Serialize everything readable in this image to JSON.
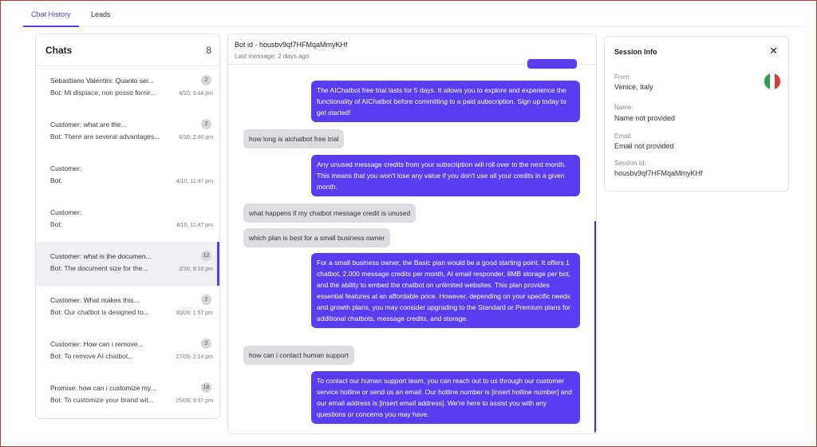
{
  "tabs": [
    {
      "label": "Chat History",
      "active": true
    },
    {
      "label": "Leads",
      "active": false
    }
  ],
  "chats": {
    "title": "Chats",
    "count": "8",
    "items": [
      {
        "name": "Sebastiano Valentini: Quanto sei...",
        "preview": "Bot: Mi dispiace, non posso fornir...",
        "date": "4/10, 9:44 pm",
        "badge": "2"
      },
      {
        "name": "Customer: what are the...",
        "preview": "Bot: There are several advantages...",
        "date": "4/10, 2:40 pm",
        "badge": "2"
      },
      {
        "name": "Customer:",
        "preview": "Bot:",
        "date": "4/10, 11:47 pm",
        "badge": ""
      },
      {
        "name": "Customer:",
        "preview": "Bot:",
        "date": "4/10, 11:47 pm",
        "badge": ""
      },
      {
        "name": "Customer: what is the documen...",
        "preview": "Bot: The document size for the...",
        "date": "2/10, 9:10 pm",
        "badge": "12"
      },
      {
        "name": "Customer: What makes this...",
        "preview": "Bot: Our chatbot is designed to...",
        "date": "30/09, 1:57 pm",
        "badge": "2"
      },
      {
        "name": "Customer: How can i remove...",
        "preview": "Bot: To remove AI chatbot...",
        "date": "27/09, 2:14 pm",
        "badge": "2"
      },
      {
        "name": "Promise: how can i customize my...",
        "preview": "Bot: To customize your brand wit...",
        "date": "25/09, 9:37 pm",
        "badge": "18"
      }
    ]
  },
  "conversation": {
    "bot_id": "Bot id - housbv9qf7HFMqaMmyKHf",
    "last_message": "Last message: 2 days ago",
    "messages": [
      {
        "from": "bot",
        "text": "The AIChatbot free trial lasts for 5 days. It allows you to explore and experience the functionality of AIChatbot before committing to a paid subscription. Sign up today to get started!"
      },
      {
        "from": "user",
        "text": "how long is aichatbot free trial"
      },
      {
        "from": "bot",
        "text": "Any unused message credits from your subscription will roll over to the next month. This means that you won't lose any value if you don't use all your credits in a given month."
      },
      {
        "from": "user",
        "text": "what happens if my chatbot message credit is unused"
      },
      {
        "from": "user",
        "text": "which plan is best for a small business owner"
      },
      {
        "from": "bot",
        "text": "For a small business owner, the Basic plan would be a good starting point. It offers 1 chatbot, 2,000 message credits per month, AI email responder, 8MB storage per bot, and the ability to embed the chatbot on unlimited websites. This plan provides essential features at an affordable price. However, depending on your specific needs and growth plans, you may consider upgrading to the Standard or Premium plans for additional chatbots, message credits, and storage."
      },
      {
        "from": "user",
        "text": "how can i contact human support"
      },
      {
        "from": "bot",
        "text": "To contact our human support team, you can reach out to us through our customer service hotline or send us an email. Our hotline number is [insert hotline number] and our email address is [insert email address]. We're here to assist you with any questions or concerns you may have."
      }
    ]
  },
  "session": {
    "title": "Session Info",
    "close_icon": "close-icon",
    "from_label": "From:",
    "from_value": "Venice, Italy",
    "flag_icon": "italy-flag-icon",
    "name_label": "Name:",
    "name_value": "Name not provided",
    "email_label": "Email:",
    "email_value": "Email not provided",
    "session_label": "Session Id:",
    "session_value": "housbv9qf7HFMqaMmyKHf"
  },
  "colors": {
    "accent": "#5a3df0",
    "user_bubble": "#dcdde3",
    "selected_row": "#efeff4"
  }
}
